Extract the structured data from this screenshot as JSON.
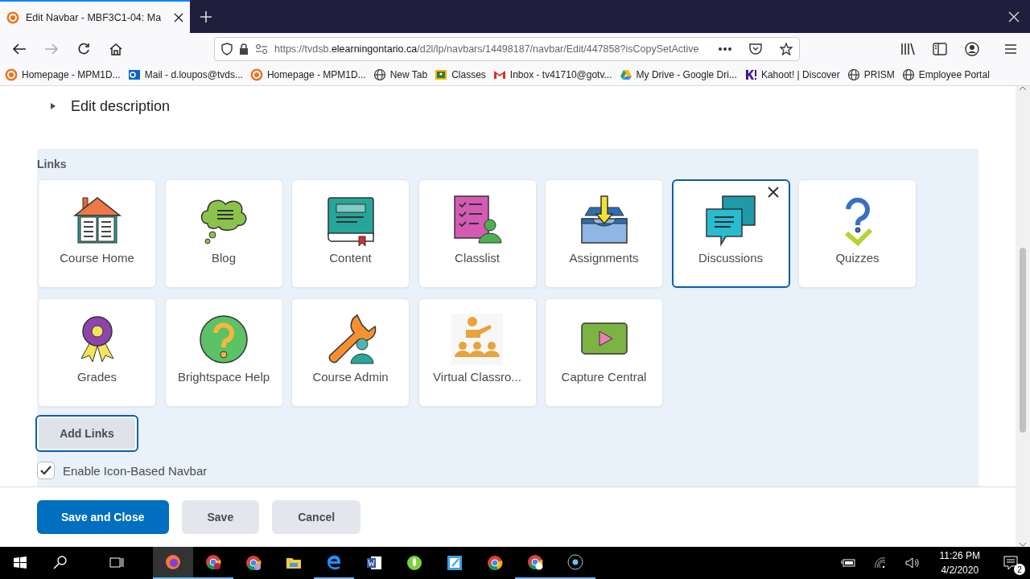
{
  "browser": {
    "tab_title": "Edit Navbar - MBF3C1-04: Ma",
    "url_host": "https://tvdsb.",
    "url_domain": "elearningontario.ca",
    "url_path": "/d2l/lp/navbars/14498187/navbar/Edit/447858?isCopySetActive",
    "bookmarks": [
      {
        "label": "Homepage - MPM1D...",
        "kind": "brightspace"
      },
      {
        "label": "Mail - d.loupos@tvds...",
        "kind": "mail"
      },
      {
        "label": "Homepage - MPM1D...",
        "kind": "brightspace"
      },
      {
        "label": "New Tab",
        "kind": "globe"
      },
      {
        "label": "Classes",
        "kind": "classes"
      },
      {
        "label": "Inbox - tv41710@gotv...",
        "kind": "gmail"
      },
      {
        "label": "My Drive - Google Dri...",
        "kind": "drive"
      },
      {
        "label": "Kahoot! | Discover",
        "kind": "kahoot"
      },
      {
        "label": "PRISM",
        "kind": "globe"
      },
      {
        "label": "Employee Portal",
        "kind": "globe"
      }
    ]
  },
  "edit_description": {
    "label": "Edit description",
    "expanded": false
  },
  "links": {
    "title": "Links",
    "tiles": [
      {
        "label": "Course Home",
        "selected": false
      },
      {
        "label": "Blog",
        "selected": false
      },
      {
        "label": "Content",
        "selected": false
      },
      {
        "label": "Classlist",
        "selected": false
      },
      {
        "label": "Assignments",
        "selected": false
      },
      {
        "label": "Discussions",
        "selected": true
      },
      {
        "label": "Quizzes",
        "selected": false
      },
      {
        "label": "Grades",
        "selected": false
      },
      {
        "label": "Brightspace Help",
        "selected": false
      },
      {
        "label": "Course Admin",
        "selected": false
      },
      {
        "label": "Virtual Classro...",
        "selected": false
      },
      {
        "label": "Capture Central",
        "selected": false
      }
    ]
  },
  "add_links_button": "Add Links",
  "icon_navbar": {
    "label": "Enable Icon-Based Navbar",
    "checked": true
  },
  "footer_buttons": [
    {
      "label": "Save and Close",
      "kind": "primary"
    },
    {
      "label": "Save",
      "kind": "secondary"
    },
    {
      "label": "Cancel",
      "kind": "secondary"
    }
  ],
  "taskbar": {
    "time": "11:26 PM",
    "date": "4/2/2020",
    "notifications": "2"
  }
}
